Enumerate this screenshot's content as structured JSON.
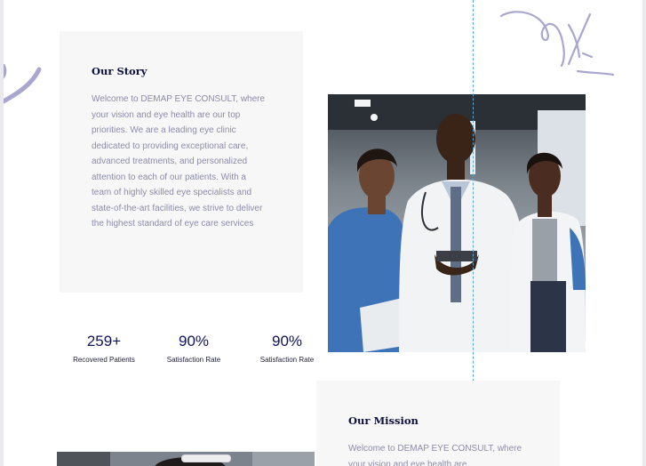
{
  "story": {
    "heading": "Our Story",
    "text": "Welcome to DEMAP EYE CONSULT, where your vision and eye health are our top priorities. We are a leading eye clinic dedicated to providing exceptional care, advanced treatments, and personalized attention to each of our patients. With a team of highly skilled eye specialists and state-of-the-art facilities, we strive to deliver the highest standard of eye care services"
  },
  "stats": [
    {
      "value": "259+",
      "label": "Recovered Patients"
    },
    {
      "value": "90%",
      "label": "Satisfaction Rate"
    },
    {
      "value": "90%",
      "label": "Satisfaction Rate"
    }
  ],
  "mission": {
    "heading": "Our Mission",
    "text": "Welcome to DEMAP EYE CONSULT, where your vision and eye health are"
  },
  "icons": [
    "doodle-arc-icon",
    "doodle-swirl-icon"
  ],
  "colors": {
    "accent": "#0e1140",
    "body_text": "#8c8ba9",
    "card_bg": "#f7f7f8",
    "doodle": "#a9a6d0"
  }
}
